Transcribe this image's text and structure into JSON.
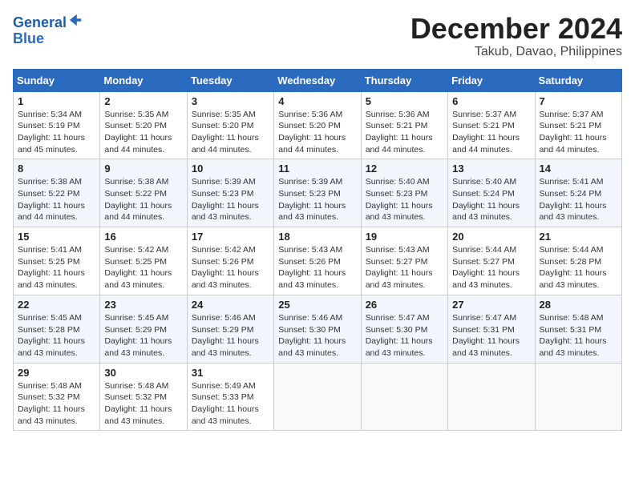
{
  "header": {
    "logo_line1": "General",
    "logo_line2": "Blue",
    "month_title": "December 2024",
    "location": "Takub, Davao, Philippines"
  },
  "calendar": {
    "days_of_week": [
      "Sunday",
      "Monday",
      "Tuesday",
      "Wednesday",
      "Thursday",
      "Friday",
      "Saturday"
    ],
    "weeks": [
      [
        null,
        {
          "day": 2,
          "sunrise": "5:35 AM",
          "sunset": "5:20 PM",
          "daylight": "11 hours and 44 minutes."
        },
        {
          "day": 3,
          "sunrise": "5:35 AM",
          "sunset": "5:20 PM",
          "daylight": "11 hours and 44 minutes."
        },
        {
          "day": 4,
          "sunrise": "5:36 AM",
          "sunset": "5:20 PM",
          "daylight": "11 hours and 44 minutes."
        },
        {
          "day": 5,
          "sunrise": "5:36 AM",
          "sunset": "5:21 PM",
          "daylight": "11 hours and 44 minutes."
        },
        {
          "day": 6,
          "sunrise": "5:37 AM",
          "sunset": "5:21 PM",
          "daylight": "11 hours and 44 minutes."
        },
        {
          "day": 7,
          "sunrise": "5:37 AM",
          "sunset": "5:21 PM",
          "daylight": "11 hours and 44 minutes."
        }
      ],
      [
        {
          "day": 1,
          "sunrise": "5:34 AM",
          "sunset": "5:19 PM",
          "daylight": "11 hours and 45 minutes."
        },
        {
          "day": 8,
          "sunrise": "5:38 AM",
          "sunset": "5:22 PM",
          "daylight": "11 hours and 44 minutes."
        },
        {
          "day": 9,
          "sunrise": "5:38 AM",
          "sunset": "5:22 PM",
          "daylight": "11 hours and 44 minutes."
        },
        {
          "day": 10,
          "sunrise": "5:39 AM",
          "sunset": "5:23 PM",
          "daylight": "11 hours and 43 minutes."
        },
        {
          "day": 11,
          "sunrise": "5:39 AM",
          "sunset": "5:23 PM",
          "daylight": "11 hours and 43 minutes."
        },
        {
          "day": 12,
          "sunrise": "5:40 AM",
          "sunset": "5:23 PM",
          "daylight": "11 hours and 43 minutes."
        },
        {
          "day": 13,
          "sunrise": "5:40 AM",
          "sunset": "5:24 PM",
          "daylight": "11 hours and 43 minutes."
        },
        {
          "day": 14,
          "sunrise": "5:41 AM",
          "sunset": "5:24 PM",
          "daylight": "11 hours and 43 minutes."
        }
      ],
      [
        {
          "day": 15,
          "sunrise": "5:41 AM",
          "sunset": "5:25 PM",
          "daylight": "11 hours and 43 minutes."
        },
        {
          "day": 16,
          "sunrise": "5:42 AM",
          "sunset": "5:25 PM",
          "daylight": "11 hours and 43 minutes."
        },
        {
          "day": 17,
          "sunrise": "5:42 AM",
          "sunset": "5:26 PM",
          "daylight": "11 hours and 43 minutes."
        },
        {
          "day": 18,
          "sunrise": "5:43 AM",
          "sunset": "5:26 PM",
          "daylight": "11 hours and 43 minutes."
        },
        {
          "day": 19,
          "sunrise": "5:43 AM",
          "sunset": "5:27 PM",
          "daylight": "11 hours and 43 minutes."
        },
        {
          "day": 20,
          "sunrise": "5:44 AM",
          "sunset": "5:27 PM",
          "daylight": "11 hours and 43 minutes."
        },
        {
          "day": 21,
          "sunrise": "5:44 AM",
          "sunset": "5:28 PM",
          "daylight": "11 hours and 43 minutes."
        }
      ],
      [
        {
          "day": 22,
          "sunrise": "5:45 AM",
          "sunset": "5:28 PM",
          "daylight": "11 hours and 43 minutes."
        },
        {
          "day": 23,
          "sunrise": "5:45 AM",
          "sunset": "5:29 PM",
          "daylight": "11 hours and 43 minutes."
        },
        {
          "day": 24,
          "sunrise": "5:46 AM",
          "sunset": "5:29 PM",
          "daylight": "11 hours and 43 minutes."
        },
        {
          "day": 25,
          "sunrise": "5:46 AM",
          "sunset": "5:30 PM",
          "daylight": "11 hours and 43 minutes."
        },
        {
          "day": 26,
          "sunrise": "5:47 AM",
          "sunset": "5:30 PM",
          "daylight": "11 hours and 43 minutes."
        },
        {
          "day": 27,
          "sunrise": "5:47 AM",
          "sunset": "5:31 PM",
          "daylight": "11 hours and 43 minutes."
        },
        {
          "day": 28,
          "sunrise": "5:48 AM",
          "sunset": "5:31 PM",
          "daylight": "11 hours and 43 minutes."
        }
      ],
      [
        {
          "day": 29,
          "sunrise": "5:48 AM",
          "sunset": "5:32 PM",
          "daylight": "11 hours and 43 minutes."
        },
        {
          "day": 30,
          "sunrise": "5:48 AM",
          "sunset": "5:32 PM",
          "daylight": "11 hours and 43 minutes."
        },
        {
          "day": 31,
          "sunrise": "5:49 AM",
          "sunset": "5:33 PM",
          "daylight": "11 hours and 43 minutes."
        },
        null,
        null,
        null,
        null
      ]
    ]
  }
}
